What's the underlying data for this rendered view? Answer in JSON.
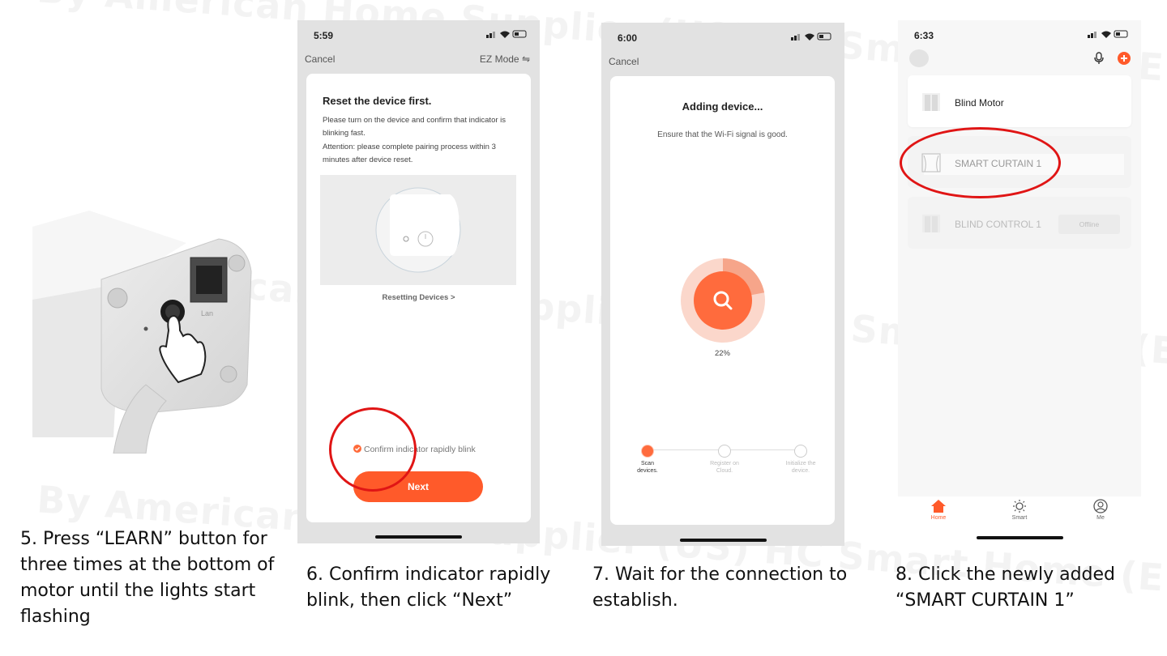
{
  "watermark": "By American Home Supplier (US) HC Smart Home (EU)",
  "captions": [
    "5. Press “LEARN” button for three times at the bottom of motor until the lights start flashing",
    "6. Confirm indicator rapidly blink, then click “Next”",
    "7. Wait for the connection to establish.",
    "8. Click the newly added “SMART CURTAIN 1”"
  ],
  "photo": {
    "port_label": "Lan"
  },
  "phone6": {
    "time": "5:59",
    "cancel": "Cancel",
    "mode": "EZ Mode ⇋",
    "title": "Reset the device first.",
    "body1": "Please turn on the device and confirm that indicator is blinking fast.",
    "body2": "Attention: please complete pairing process within 3 minutes after device reset.",
    "reset_link": "Resetting Devices >",
    "confirm": "Confirm indicator rapidly blink",
    "next": "Next"
  },
  "phone7": {
    "time": "6:00",
    "cancel": "Cancel",
    "title": "Adding device...",
    "subtitle": "Ensure that the Wi-Fi signal is good.",
    "progress": "22%",
    "progress_value": 0.22,
    "steps": [
      {
        "label": "Scan devices.",
        "active": true
      },
      {
        "label": "Register on Cloud.",
        "active": false
      },
      {
        "label": "Initialize the device.",
        "active": false
      }
    ]
  },
  "phone8": {
    "time": "6:33",
    "devices": [
      {
        "name": "Blind Motor",
        "status": ""
      },
      {
        "name": "SMART CURTAIN 1",
        "status": ""
      },
      {
        "name": "BLIND CONTROL 1",
        "status": "Offline"
      }
    ],
    "tabs": [
      "Home",
      "Smart",
      "Me"
    ]
  },
  "colors": {
    "accent": "#ff5a2a",
    "highlight": "#e01515"
  }
}
